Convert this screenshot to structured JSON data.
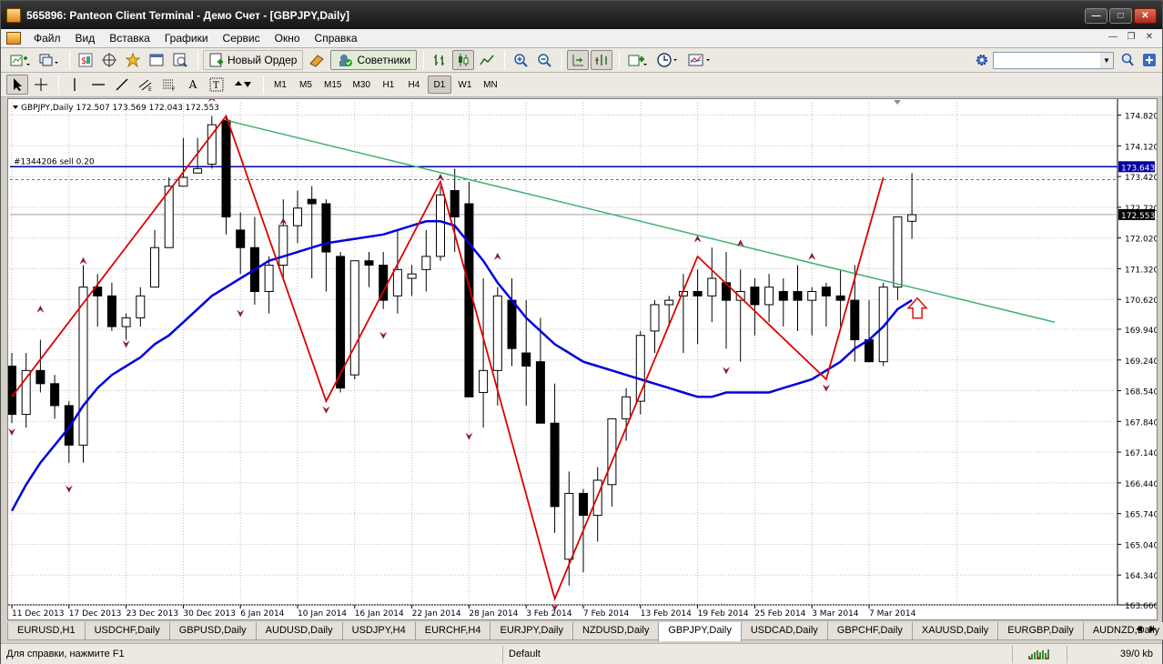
{
  "window": {
    "title": "565896: Panteon Client Terminal - Демо Счет - [GBPJPY,Daily]"
  },
  "menu": [
    "Файл",
    "Вид",
    "Вставка",
    "Графики",
    "Сервис",
    "Окно",
    "Справка"
  ],
  "toolbar": {
    "new_order": "Новый Ордер",
    "experts": "Советники",
    "search_placeholder": ""
  },
  "timeframes": [
    {
      "label": "M1",
      "active": false
    },
    {
      "label": "M5",
      "active": false
    },
    {
      "label": "M15",
      "active": false
    },
    {
      "label": "M30",
      "active": false
    },
    {
      "label": "H1",
      "active": false
    },
    {
      "label": "H4",
      "active": false
    },
    {
      "label": "D1",
      "active": true
    },
    {
      "label": "W1",
      "active": false
    },
    {
      "label": "MN",
      "active": false
    }
  ],
  "chart": {
    "header": "GBPJPY,Daily  172.507 173.569 172.043 172.553",
    "order_label": "#1344206 sell 0.20",
    "order_price": 173.643,
    "current_price": 172.553,
    "order_price_label": "173.643",
    "current_price_label": "172.553",
    "y_min": 163.66,
    "y_max": 175.1,
    "price_ticks": [
      "174.820",
      "174.120",
      "173.420",
      "172.720",
      "172.020",
      "171.320",
      "170.620",
      "169.940",
      "169.240",
      "168.540",
      "167.840",
      "167.140",
      "166.440",
      "165.740",
      "165.040",
      "164.340",
      "163.660"
    ],
    "date_labels": [
      "11 Dec 2013",
      "17 Dec 2013",
      "23 Dec 2013",
      "30 Dec 2013",
      "6 Jan 2014",
      "10 Jan 2014",
      "16 Jan 2014",
      "22 Jan 2014",
      "28 Jan 2014",
      "3 Feb 2014",
      "7 Feb 2014",
      "13 Feb 2014",
      "19 Feb 2014",
      "25 Feb 2014",
      "3 Mar 2014",
      "7 Mar 2014"
    ],
    "colors": {
      "order_line": "#0000a0",
      "ma": "#0000dd",
      "zigzag": "#dd0000",
      "trend": "#3cb371",
      "fractal": "#8b1a3a",
      "grid": "#c0c0c0"
    },
    "candles": [
      [
        169.1,
        169.4,
        167.8,
        168.0
      ],
      [
        168.0,
        169.4,
        167.7,
        169.0
      ],
      [
        169.0,
        169.7,
        168.5,
        168.7
      ],
      [
        168.7,
        168.9,
        167.9,
        168.2
      ],
      [
        168.2,
        168.3,
        166.9,
        167.3
      ],
      [
        167.3,
        171.4,
        166.9,
        170.9
      ],
      [
        170.9,
        171.2,
        170.0,
        170.7
      ],
      [
        170.7,
        171.0,
        169.9,
        170.0
      ],
      [
        170.0,
        170.3,
        169.7,
        170.2
      ],
      [
        170.2,
        170.9,
        170.0,
        170.7
      ],
      [
        170.9,
        172.2,
        171.2,
        171.8
      ],
      [
        171.8,
        173.4,
        171.8,
        173.2
      ],
      [
        173.2,
        174.3,
        173.3,
        173.4
      ],
      [
        173.5,
        174.3,
        173.5,
        173.6
      ],
      [
        173.7,
        174.8,
        173.6,
        174.6
      ],
      [
        174.7,
        174.8,
        172.1,
        172.5
      ],
      [
        172.2,
        172.6,
        171.2,
        171.8
      ],
      [
        171.8,
        172.5,
        170.5,
        170.8
      ],
      [
        170.8,
        171.6,
        170.3,
        171.4
      ],
      [
        171.4,
        172.9,
        171.1,
        172.3
      ],
      [
        172.3,
        173.1,
        171.9,
        172.7
      ],
      [
        172.9,
        173.2,
        171.1,
        172.8
      ],
      [
        172.8,
        172.9,
        170.8,
        171.7
      ],
      [
        171.6,
        171.7,
        168.5,
        168.6
      ],
      [
        168.9,
        171.5,
        168.8,
        171.5
      ],
      [
        171.5,
        171.7,
        170.9,
        171.4
      ],
      [
        171.4,
        171.7,
        170.4,
        170.6
      ],
      [
        170.7,
        172.2,
        170.3,
        171.3
      ],
      [
        171.1,
        171.4,
        170.7,
        171.2
      ],
      [
        171.3,
        172.2,
        170.8,
        171.6
      ],
      [
        171.6,
        173.2,
        171.5,
        173.0
      ],
      [
        173.1,
        173.6,
        171.7,
        172.5
      ],
      [
        172.8,
        173.3,
        168.4,
        168.4
      ],
      [
        168.5,
        171.1,
        167.7,
        169.0
      ],
      [
        169.0,
        170.9,
        168.2,
        170.7
      ],
      [
        170.6,
        171.1,
        169.1,
        169.5
      ],
      [
        169.4,
        170.6,
        168.2,
        169.1
      ],
      [
        169.2,
        170.2,
        168.2,
        167.8
      ],
      [
        167.8,
        168.7,
        165.3,
        165.9
      ],
      [
        164.7,
        166.7,
        164.1,
        166.2
      ],
      [
        166.2,
        166.3,
        164.4,
        165.7
      ],
      [
        165.7,
        166.8,
        165.1,
        166.5
      ],
      [
        166.4,
        167.9,
        165.9,
        167.9
      ],
      [
        167.9,
        168.6,
        167.4,
        168.4
      ],
      [
        168.3,
        169.9,
        168.0,
        169.8
      ],
      [
        169.9,
        170.6,
        169.4,
        170.5
      ],
      [
        170.5,
        170.7,
        170.0,
        170.6
      ],
      [
        170.7,
        171.2,
        169.4,
        170.8
      ],
      [
        170.8,
        171.3,
        169.6,
        170.7
      ],
      [
        170.7,
        171.8,
        170.1,
        171.1
      ],
      [
        171.0,
        171.7,
        169.5,
        170.6
      ],
      [
        170.6,
        171.3,
        169.2,
        170.8
      ],
      [
        170.9,
        171.1,
        169.8,
        170.5
      ],
      [
        170.5,
        171.2,
        170.1,
        170.9
      ],
      [
        170.8,
        171.1,
        170.0,
        170.6
      ],
      [
        170.8,
        171.4,
        169.9,
        170.6
      ],
      [
        170.6,
        170.9,
        169.8,
        170.8
      ],
      [
        170.9,
        171.0,
        170.0,
        170.7
      ],
      [
        170.7,
        171.3,
        170.0,
        170.6
      ],
      [
        170.6,
        171.4,
        169.2,
        169.7
      ],
      [
        169.7,
        170.6,
        169.3,
        169.2
      ],
      [
        169.2,
        171.0,
        169.1,
        170.9
      ],
      [
        170.9,
        172.2,
        170.6,
        172.5
      ],
      [
        172.4,
        173.5,
        172.0,
        172.55
      ]
    ],
    "ma": [
      165.8,
      166.4,
      166.9,
      167.3,
      167.7,
      168.2,
      168.6,
      168.9,
      169.1,
      169.3,
      169.6,
      169.8,
      170.1,
      170.4,
      170.7,
      170.9,
      171.1,
      171.3,
      171.5,
      171.6,
      171.7,
      171.8,
      171.9,
      171.95,
      172.0,
      172.05,
      172.1,
      172.2,
      172.3,
      172.4,
      172.4,
      172.3,
      171.9,
      171.5,
      171.0,
      170.6,
      170.2,
      169.9,
      169.6,
      169.4,
      169.2,
      169.1,
      169.0,
      168.9,
      168.8,
      168.7,
      168.6,
      168.5,
      168.4,
      168.4,
      168.5,
      168.5,
      168.5,
      168.5,
      168.6,
      168.7,
      168.8,
      169.0,
      169.2,
      169.5,
      169.7,
      170.0,
      170.4,
      170.6
    ],
    "zigzag": [
      [
        0,
        168.4
      ],
      [
        15,
        174.8
      ],
      [
        22,
        168.3
      ],
      [
        30,
        173.3
      ],
      [
        38,
        163.8
      ],
      [
        48,
        171.6
      ],
      [
        57,
        168.8
      ],
      [
        61,
        173.4
      ]
    ],
    "trend": [
      [
        15,
        174.7
      ],
      [
        73,
        170.1
      ]
    ],
    "fractals_up": [
      [
        2,
        170.4
      ],
      [
        5,
        171.5
      ],
      [
        14,
        175.2
      ],
      [
        19,
        172.4
      ],
      [
        30,
        173.4
      ],
      [
        34,
        171.6
      ],
      [
        48,
        172.0
      ],
      [
        51,
        171.9
      ],
      [
        56,
        171.6
      ]
    ],
    "fractals_down": [
      [
        0,
        167.6
      ],
      [
        4,
        166.3
      ],
      [
        8,
        169.6
      ],
      [
        16,
        170.3
      ],
      [
        22,
        168.1
      ],
      [
        26,
        169.8
      ],
      [
        32,
        167.5
      ],
      [
        38,
        163.6
      ],
      [
        50,
        169.0
      ],
      [
        57,
        168.6
      ]
    ],
    "arrow_up": [
      63,
      170.4
    ]
  },
  "symbol_tabs": [
    {
      "label": "EURUSD,H1",
      "active": false
    },
    {
      "label": "USDCHF,Daily",
      "active": false
    },
    {
      "label": "GBPUSD,Daily",
      "active": false
    },
    {
      "label": "AUDUSD,Daily",
      "active": false
    },
    {
      "label": "USDJPY,H4",
      "active": false
    },
    {
      "label": "EURCHF,H4",
      "active": false
    },
    {
      "label": "EURJPY,Daily",
      "active": false
    },
    {
      "label": "NZDUSD,Daily",
      "active": false
    },
    {
      "label": "GBPJPY,Daily",
      "active": true
    },
    {
      "label": "USDCAD,Daily",
      "active": false
    },
    {
      "label": "GBPCHF,Daily",
      "active": false
    },
    {
      "label": "XAUUSD,Daily",
      "active": false
    },
    {
      "label": "EURGBP,Daily",
      "active": false
    },
    {
      "label": "AUDNZD,Daily",
      "active": false
    }
  ],
  "status": {
    "help": "Для справки, нажмите F1",
    "profile": "Default",
    "traffic": "39/0 kb"
  }
}
